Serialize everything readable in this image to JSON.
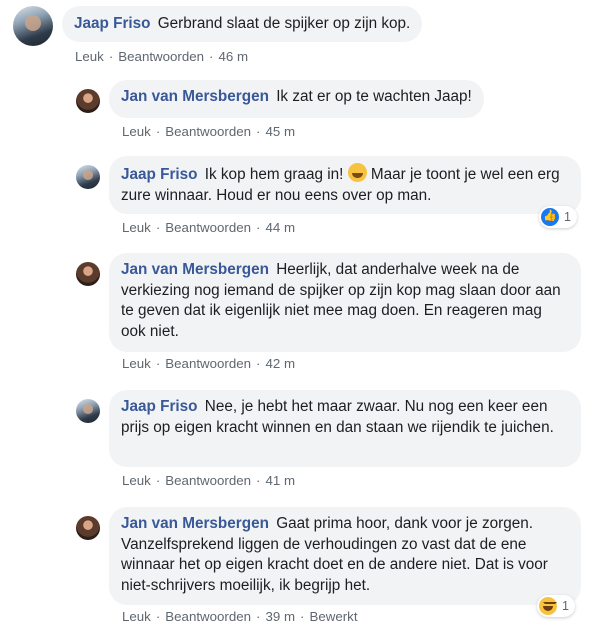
{
  "actions": {
    "like": "Leuk",
    "reply": "Beantwoorden",
    "edited": "Bewerkt",
    "separator": "·"
  },
  "comments": [
    {
      "author": "Jaap Friso",
      "text": "Gerbrand slaat de spijker op zijn kop.",
      "time": "46 m"
    },
    {
      "author": "Jan van Mersbergen",
      "text": "Ik zat er op te wachten Jaap!",
      "time": "45 m"
    },
    {
      "author": "Jaap Friso",
      "text_before_emoji": "Ik kop hem graag in!",
      "emoji": "smiling-face-with-hearts",
      "text_after_emoji": "Maar je toont je wel een erg zure winnaar. Houd er nou eens over op man.",
      "time": "44 m",
      "reaction": {
        "type": "like",
        "count": "1"
      }
    },
    {
      "author": "Jan van Mersbergen",
      "text": "Heerlijk, dat anderhalve week na de verkiezing nog iemand de spijker op zijn kop mag slaan door aan te geven dat ik eigenlijk niet mee mag doen. En reageren mag ook niet.",
      "time": "42 m"
    },
    {
      "author": "Jaap Friso",
      "text": "Nee, je hebt het maar zwaar. Nu nog een keer een prijs op eigen kracht winnen en dan staan we rijendik te juichen.",
      "time": "41 m"
    },
    {
      "author": "Jan van Mersbergen",
      "text": "Gaat prima hoor, dank voor je zorgen. Vanzelfsprekend liggen de verhoudingen zo vast dat de ene winnaar het op eigen kracht doet en de andere niet. Dat is voor niet-schrijvers moeilijk, ik begrijp het.",
      "time": "39 m",
      "edited": true,
      "reaction": {
        "type": "haha",
        "count": "1"
      }
    }
  ]
}
